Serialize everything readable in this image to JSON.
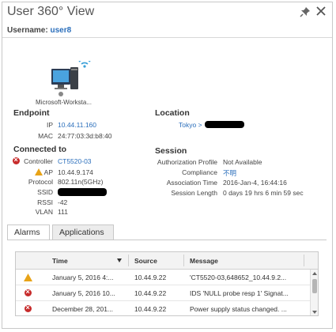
{
  "header": {
    "title": "User 360° View",
    "username_label": "Username:",
    "username_value": "user8"
  },
  "device": {
    "label": "Microsoft-Worksta..."
  },
  "endpoint": {
    "title": "Endpoint",
    "ip_label": "IP",
    "ip_value": "10.44.11.160",
    "mac_label": "MAC",
    "mac_value": "24:77:03:3d:b8:40"
  },
  "connected": {
    "title": "Connected to",
    "controller_label": "Controller",
    "controller_value": "CT5520-03",
    "ap_label": "AP",
    "ap_value": "10.44.9.174",
    "protocol_label": "Protocol",
    "protocol_value": "802.11n(5GHz)",
    "ssid_label": "SSID",
    "rssi_label": "RSSI",
    "rssi_value": "-42",
    "vlan_label": "VLAN",
    "vlan_value": "111"
  },
  "location": {
    "title": "Location",
    "value": "Tokyo >"
  },
  "session": {
    "title": "Session",
    "auth_label": "Authorization Profile",
    "auth_value": "Not Available",
    "compliance_label": "Compliance",
    "compliance_value": "不明",
    "assoc_label": "Association Time",
    "assoc_value": "2016-Jan-4, 16:44:16",
    "length_label": "Session Length",
    "length_value": "0 days 19 hrs 6 min 59 sec"
  },
  "tabs": [
    {
      "label": "Alarms"
    },
    {
      "label": "Applications"
    }
  ],
  "alarms": {
    "columns": {
      "time": "Time",
      "source": "Source",
      "message": "Message"
    },
    "rows": [
      {
        "severity": "warning",
        "time": "January 5, 2016 4:...",
        "source": "10.44.9.22",
        "message": "'CT5520-03,648652_10.44.9.2..."
      },
      {
        "severity": "critical",
        "time": "January 5, 2016 10...",
        "source": "10.44.9.22",
        "message": "IDS 'NULL probe resp 1' Signat..."
      },
      {
        "severity": "critical",
        "time": "December 28, 201...",
        "source": "10.44.9.22",
        "message": "Power supply status changed. ..."
      }
    ]
  },
  "colors": {
    "link": "#2a6ebb",
    "critical": "#c72b2b",
    "warning": "#e8a317"
  },
  "icons": [
    "pin-icon",
    "close-icon",
    "computer-wireless-icon",
    "warning-icon",
    "critical-icon",
    "sort-descending-icon"
  ]
}
